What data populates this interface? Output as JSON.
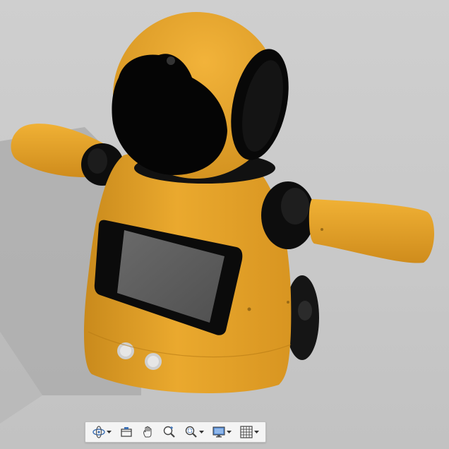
{
  "viewer": {
    "background_color": "#c8c8c8",
    "model": {
      "body_color": "#e7a52c",
      "dark_color": "#0a0a0a",
      "screen_color": "#5d5d5d"
    }
  },
  "navigation_bar": {
    "tools": [
      {
        "name": "orbit",
        "icon": "orbit-icon",
        "has_dropdown": true
      },
      {
        "name": "look-at",
        "icon": "look-at-icon",
        "has_dropdown": false
      },
      {
        "name": "pan",
        "icon": "hand-icon",
        "has_dropdown": false
      },
      {
        "name": "zoom",
        "icon": "zoom-icon",
        "has_dropdown": false
      },
      {
        "name": "fit",
        "icon": "zoom-window-icon",
        "has_dropdown": true
      },
      {
        "name": "display-settings",
        "icon": "monitor-icon",
        "has_dropdown": true
      },
      {
        "name": "grid-settings",
        "icon": "grid-icon",
        "has_dropdown": true
      }
    ]
  }
}
